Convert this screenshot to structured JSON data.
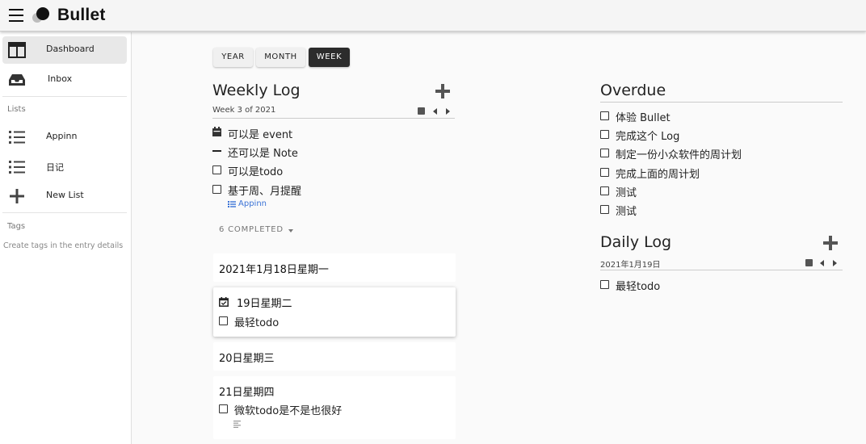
{
  "app": {
    "brand": "Bullet"
  },
  "icons": {
    "menu": "hamburger-icon",
    "logo": "bullet-logo-icon",
    "dashboard": "dashboard-icon",
    "inbox": "inbox-icon",
    "list": "list-icon",
    "add": "plus-icon",
    "calendar": "calendar-icon",
    "prev": "chevron-left-icon",
    "next": "chevron-right-icon",
    "note": "note-dash-icon",
    "checkbox": "checkbox-icon",
    "event": "event-icon",
    "caret": "caret-down-icon",
    "notes": "notes-icon"
  },
  "sidebar": {
    "dashboard": "Dashboard",
    "inbox": "Inbox",
    "lists_header": "Lists",
    "lists": [
      {
        "label": "Appinn"
      },
      {
        "label": "日记"
      }
    ],
    "new_list": "New List",
    "tags_header": "Tags",
    "tags_hint": "Create tags in the entry details"
  },
  "views": {
    "year": "YEAR",
    "month": "MONTH",
    "week": "WEEK",
    "selected": "WEEK"
  },
  "weekly": {
    "title": "Weekly Log",
    "subtitle": "Week 3 of 2021",
    "entries": [
      {
        "type": "event",
        "text": "可以是 event"
      },
      {
        "type": "note",
        "text": "还可以是 Note"
      },
      {
        "type": "todo",
        "text": "可以是todo"
      },
      {
        "type": "todo",
        "text": "基于周、月提醒"
      }
    ],
    "tag_link": "Appinn",
    "completed": "6 COMPLETED"
  },
  "days": [
    {
      "title": "2021年1月18日星期一"
    },
    {
      "title": "19日星期二",
      "entries": [
        "最轻todo"
      ]
    },
    {
      "title": "20日星期三"
    },
    {
      "title": "21日星期四",
      "entries": [
        "微软todo是不是也很好"
      ]
    }
  ],
  "overdue": {
    "title": "Overdue",
    "entries": [
      "体验 Bullet",
      "完成这个 Log",
      "制定一份小众软件的周计划",
      "完成上面的周计划",
      "测试",
      "测试"
    ]
  },
  "daily": {
    "title": "Daily Log",
    "subtitle": "2021年1月19日",
    "entries": [
      "最轻todo"
    ]
  }
}
